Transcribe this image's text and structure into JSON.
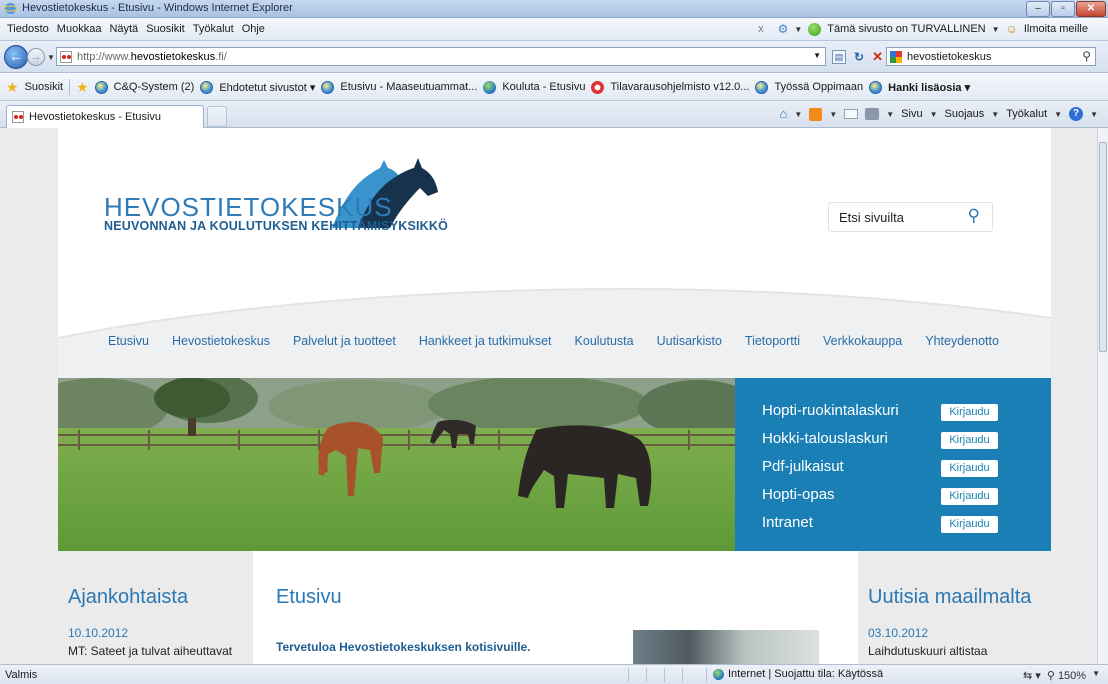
{
  "window": {
    "title": "Hevostietokeskus - Etusivu - Windows Internet Explorer"
  },
  "menubar": {
    "items": [
      "Tiedosto",
      "Muokkaa",
      "Näytä",
      "Suosikit",
      "Työkalut",
      "Ohje"
    ],
    "security_text": "Tämä sivusto on TURVALLINEN",
    "report_text": "Ilmoita meille"
  },
  "addressbar": {
    "url_prefix": "http://www.",
    "url_domain": "hevostietokeskus",
    "url_suffix": ".fi/",
    "search_value": "hevostietokeskus"
  },
  "favorites": {
    "label": "Suosikit",
    "items": [
      "C&Q-System (2)",
      "Ehdotetut sivustot ▾",
      "Etusivu - Maaseutuammat...",
      "Kouluta - Etusivu",
      "Tilavarausohjelmisto v12.0...",
      "Työssä Oppimaan",
      "Hanki lisäosia ▾"
    ]
  },
  "tabs": {
    "active_label": "Hevostietokeskus - Etusivu"
  },
  "commandbar": {
    "page": "Sivu",
    "safety": "Suojaus",
    "tools": "Työkalut"
  },
  "site": {
    "logo_title": "HEVOSTIETOKESKUS",
    "logo_subtitle": "NEUVONNAN JA KOULUTUKSEN KEHITTÄMISYKSIKKÖ",
    "search_label": "Etsi sivuilta",
    "nav": [
      "Etusivu",
      "Hevostietokeskus",
      "Palvelut ja tuotteet",
      "Hankkeet ja tutkimukset",
      "Koulutusta",
      "Uutisarkisto",
      "Tietoportti",
      "Verkkokauppa",
      "Yhteydenotto"
    ],
    "services": [
      {
        "name": "Hopti-ruokintalaskuri",
        "button": "Kirjaudu"
      },
      {
        "name": "Hokki-talouslaskuri",
        "button": "Kirjaudu"
      },
      {
        "name": "Pdf-julkaisut",
        "button": "Kirjaudu"
      },
      {
        "name": "Hopti-opas",
        "button": "Kirjaudu"
      },
      {
        "name": "Intranet",
        "button": "Kirjaudu"
      }
    ],
    "left": {
      "heading": "Ajankohtaista",
      "date": "10.10.2012",
      "news": "MT: Sateet ja tulvat aiheuttavat"
    },
    "middle": {
      "heading": "Etusivu",
      "welcome": "Tervetuloa Hevostietokeskuksen kotisivuille."
    },
    "right": {
      "heading": "Uutisia maailmalta",
      "date": "03.10.2012",
      "news": "Laihdutuskuuri altistaa"
    }
  },
  "statusbar": {
    "status": "Valmis",
    "zone": "Internet | Suojattu tila: Käytössä",
    "zoom": "150%"
  }
}
